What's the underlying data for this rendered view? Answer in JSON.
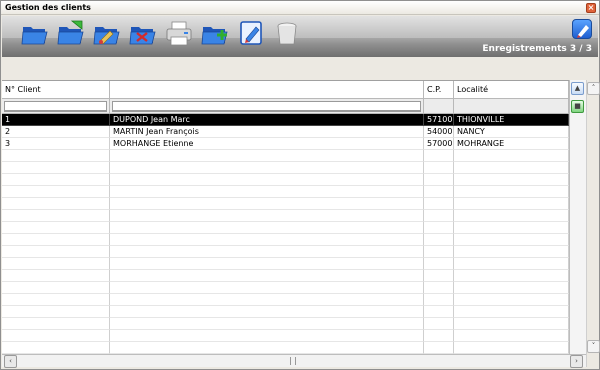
{
  "window": {
    "title": "Gestion des clients"
  },
  "toolbar": {
    "records_label": "Enregistrements 3 / 3",
    "buttons": [
      {
        "icon": "folder-open-icon"
      },
      {
        "icon": "folder-new-icon"
      },
      {
        "icon": "folder-edit-icon"
      },
      {
        "icon": "folder-delete-icon"
      },
      {
        "icon": "printer-icon"
      },
      {
        "icon": "folder-add-icon"
      },
      {
        "icon": "document-edit-icon"
      },
      {
        "icon": "trash-icon"
      }
    ]
  },
  "grid": {
    "columns": [
      "N° Client",
      "",
      "C.P.",
      "Localité"
    ],
    "rows": [
      {
        "num": "1",
        "name": "DUPOND Jean Marc",
        "cp": "57100",
        "city": "THIONVILLE",
        "selected": true
      },
      {
        "num": "2",
        "name": "MARTIN Jean François",
        "cp": "54000",
        "city": "NANCY",
        "selected": false
      },
      {
        "num": "3",
        "name": "MORHANGE Etienne",
        "cp": "57000",
        "city": "MOHRANGE",
        "selected": false
      }
    ]
  },
  "colors": {
    "selection": "#000000",
    "toolbar_dark": "#6f6f6f",
    "folder_blue": "#2f6fd6"
  }
}
